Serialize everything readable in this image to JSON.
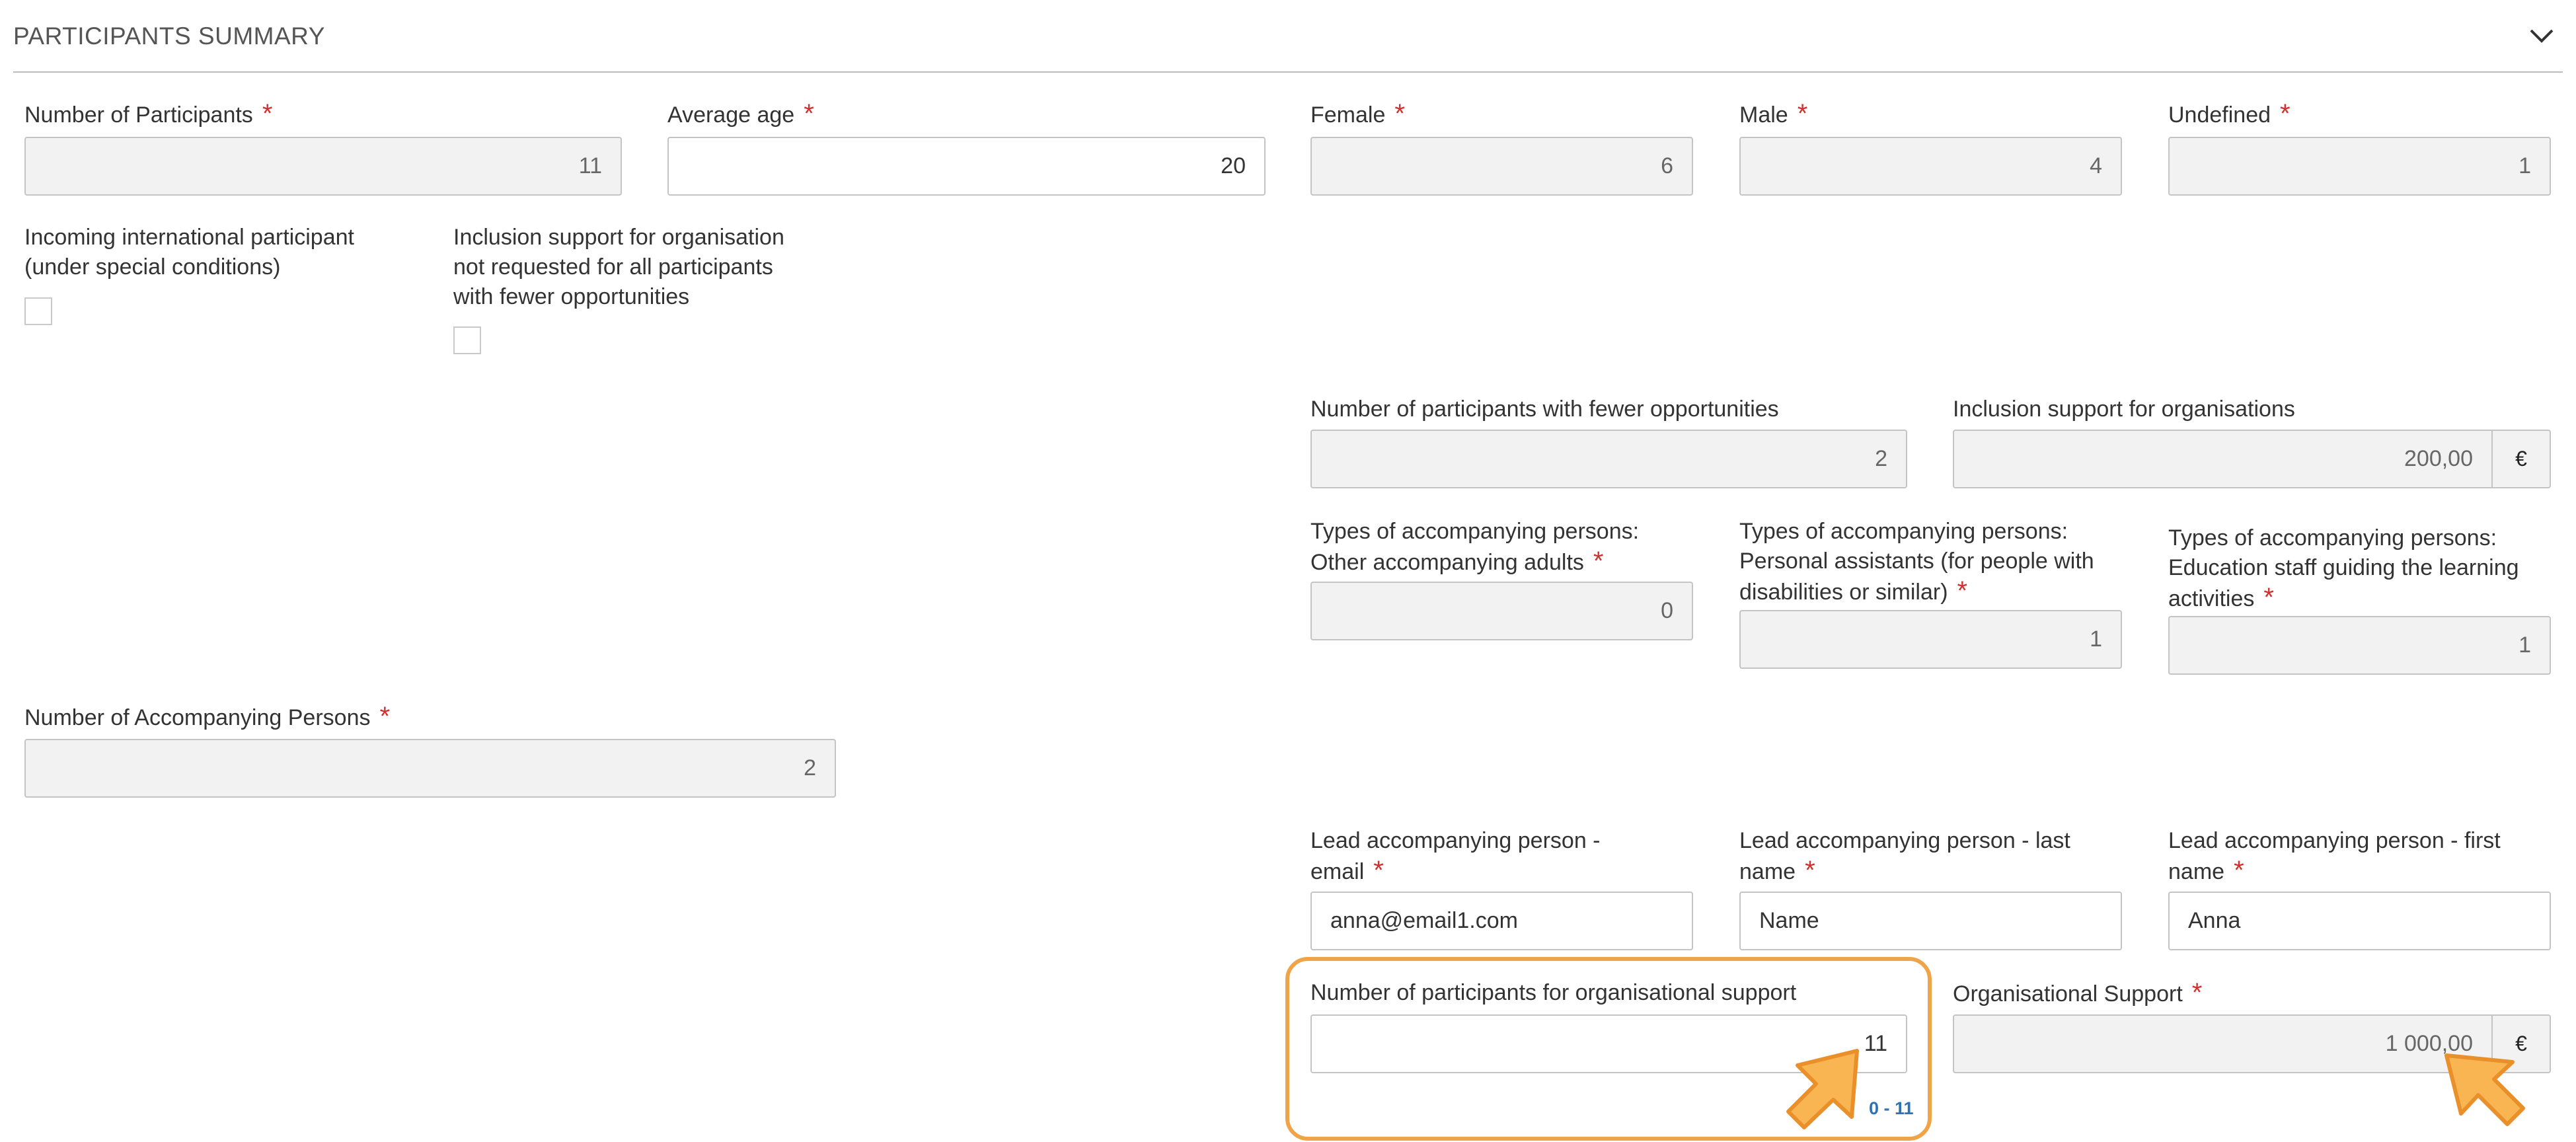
{
  "section": {
    "title": "PARTICIPANTS SUMMARY"
  },
  "fields": {
    "num_participants": {
      "label": "Number of Participants",
      "value": "11"
    },
    "average_age": {
      "label": "Average age",
      "value": "20"
    },
    "female": {
      "label": "Female",
      "value": "6"
    },
    "male": {
      "label": "Male",
      "value": "4"
    },
    "undefined": {
      "label": "Undefined",
      "value": "1"
    },
    "incoming_international": {
      "label_line1": "Incoming international participant",
      "label_line2": "(under special conditions)",
      "checked": false
    },
    "inclusion_not_requested": {
      "label_line1": "Inclusion support for organisation",
      "label_line2": "not requested for all participants",
      "label_line3": "with fewer opportunities",
      "checked": false
    },
    "fewer_opportunities": {
      "label": "Number of participants with fewer opportunities",
      "value": "2"
    },
    "inclusion_support": {
      "label": "Inclusion support for organisations",
      "value": "200,00",
      "currency": "€"
    },
    "acc_other_adults": {
      "label_line1": "Types of accompanying persons:",
      "label_line2": "Other accompanying adults",
      "value": "0"
    },
    "acc_personal_assistants": {
      "label_line1": "Types of accompanying persons:",
      "label_line2": "Personal assistants (for people with",
      "label_line3": "disabilities or similar)",
      "value": "1"
    },
    "acc_education_staff": {
      "label_line1": "Types of accompanying persons:",
      "label_line2": "Education staff guiding the learning",
      "label_line3": "activities",
      "value": "1"
    },
    "num_accompanying": {
      "label": "Number of Accompanying Persons",
      "value": "2"
    },
    "lead_email": {
      "label_line1": "Lead accompanying person -",
      "label_line2": "email",
      "value": "anna@email1.com"
    },
    "lead_last_name": {
      "label_line1": "Lead accompanying person - last",
      "label_line2": "name",
      "value": "Name"
    },
    "lead_first_name": {
      "label_line1": "Lead accompanying person - first",
      "label_line2": "name",
      "value": "Anna"
    },
    "org_support_participants": {
      "label": "Number of participants for organisational support",
      "value": "11",
      "range_hint": "0 - 11"
    },
    "org_support": {
      "label": "Organisational Support",
      "value": "1 000,00",
      "currency": "€"
    }
  },
  "required_marker": "*",
  "colors": {
    "highlight": "#f0a44a",
    "required": "#d32f2f",
    "range_hint": "#2d73b4",
    "readonly_bg": "#f2f2f2"
  },
  "icons": {
    "collapse": "chevron-down-icon",
    "pointer": "arrow-pointer-icon"
  }
}
